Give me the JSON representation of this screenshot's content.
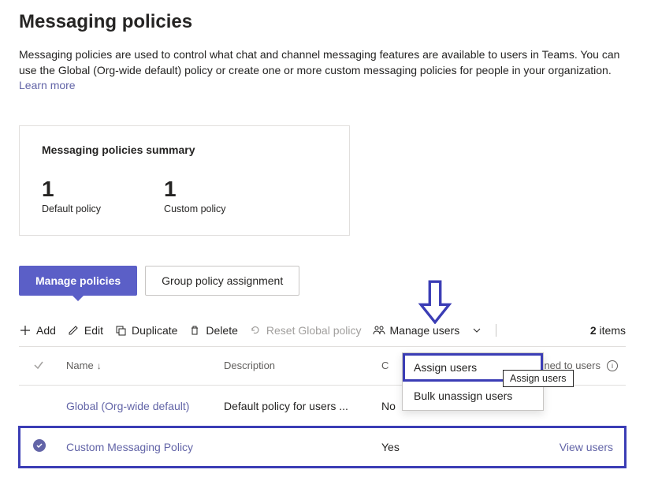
{
  "page": {
    "title": "Messaging policies",
    "description": "Messaging policies are used to control what chat and channel messaging features are available to users in Teams. You can use the Global (Org-wide default) policy or create one or more custom messaging policies for people in your organization. ",
    "learn_more": "Learn more"
  },
  "summary": {
    "title": "Messaging policies summary",
    "default_count": "1",
    "default_label": "Default policy",
    "custom_count": "1",
    "custom_label": "Custom policy"
  },
  "tabs": {
    "manage": "Manage policies",
    "group": "Group policy assignment"
  },
  "toolbar": {
    "add": "Add",
    "edit": "Edit",
    "duplicate": "Duplicate",
    "delete": "Delete",
    "reset": "Reset Global policy",
    "manage_users": "Manage users",
    "items_count": "2",
    "items_label": " items"
  },
  "dropdown": {
    "assign": "Assign users",
    "bulk_unassign": "Bulk unassign users",
    "tooltip": "Assign users"
  },
  "table": {
    "headers": {
      "name": "Name",
      "description": "Description",
      "custom_policy": "C",
      "assigned": "signed to users"
    },
    "rows": [
      {
        "name": "Global (Org-wide default)",
        "description": "Default policy for users ...",
        "custom": "No",
        "view": ""
      },
      {
        "name": "Custom Messaging Policy",
        "description": "",
        "custom": "Yes",
        "view": "View users"
      }
    ]
  }
}
